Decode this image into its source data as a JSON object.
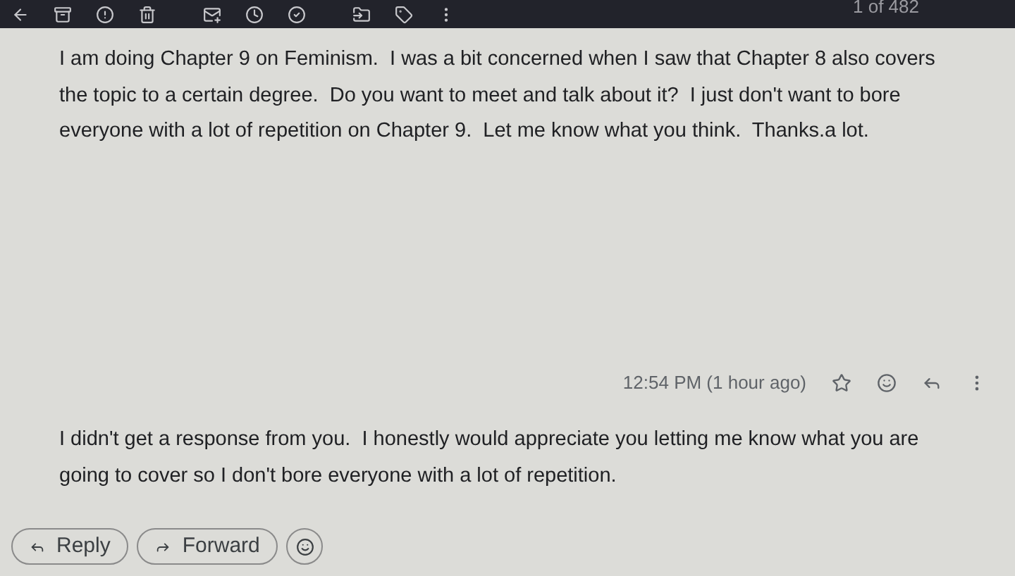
{
  "toolbar": {
    "counter": "1 of 482"
  },
  "messages": [
    {
      "body": "I am doing Chapter 9 on Feminism.  I was a bit concerned when I saw that Chapter 8 also covers the topic to a certain degree.  Do you want to meet and talk about it?  I just don't want to bore everyone with a lot of repetition on Chapter 9.  Let me know what you think.  Thanks.a lot."
    },
    {
      "time": "12:54 PM (1 hour ago)",
      "starred": false,
      "body": "I didn't get a response from you.  I honestly would appreciate you letting me know what you are going to cover so I don't bore everyone with a lot of repetition."
    }
  ],
  "actions": [
    "Reply",
    "Forward"
  ]
}
